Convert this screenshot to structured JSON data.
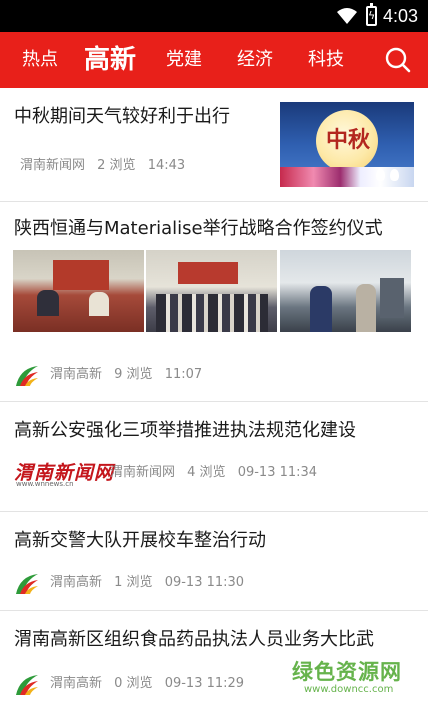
{
  "status_bar": {
    "time": "4:03",
    "icons": [
      "wifi-icon",
      "battery-charging-icon"
    ]
  },
  "nav": {
    "tabs": [
      {
        "label": "热点",
        "active": false
      },
      {
        "label": "高新",
        "active": true
      },
      {
        "label": "党建",
        "active": false
      },
      {
        "label": "经济",
        "active": false
      },
      {
        "label": "科技",
        "active": false
      }
    ],
    "search_icon": "search-icon",
    "accent_color": "#e8201a"
  },
  "articles": [
    {
      "title": "中秋期间天气较好利于出行",
      "source": "渭南新闻网",
      "views": "2 浏览",
      "time": "14:43",
      "thumbnail_text": "中秋"
    },
    {
      "title": "陕西恒通与Materialise举行战略合作签约仪式",
      "source": "渭南高新",
      "views": "9 浏览",
      "time": "11:07"
    },
    {
      "title": "高新公安强化三项举措推进执法规范化建设",
      "source": "渭南新闻网",
      "views": "4 浏览",
      "time": "09-13 11:34",
      "logo_text": "渭南新闻网",
      "logo_url": "www.wnnews.cn"
    },
    {
      "title": "高新交警大队开展校车整治行动",
      "source": "渭南高新",
      "views": "1 浏览",
      "time": "09-13 11:30"
    },
    {
      "title": "渭南高新区组织食品药品执法人员业务大比武",
      "source": "渭南高新",
      "views": "0 浏览",
      "time": "09-13 11:29"
    }
  ],
  "watermark": {
    "text": "绿色资源网",
    "url": "www.downcc.com"
  }
}
